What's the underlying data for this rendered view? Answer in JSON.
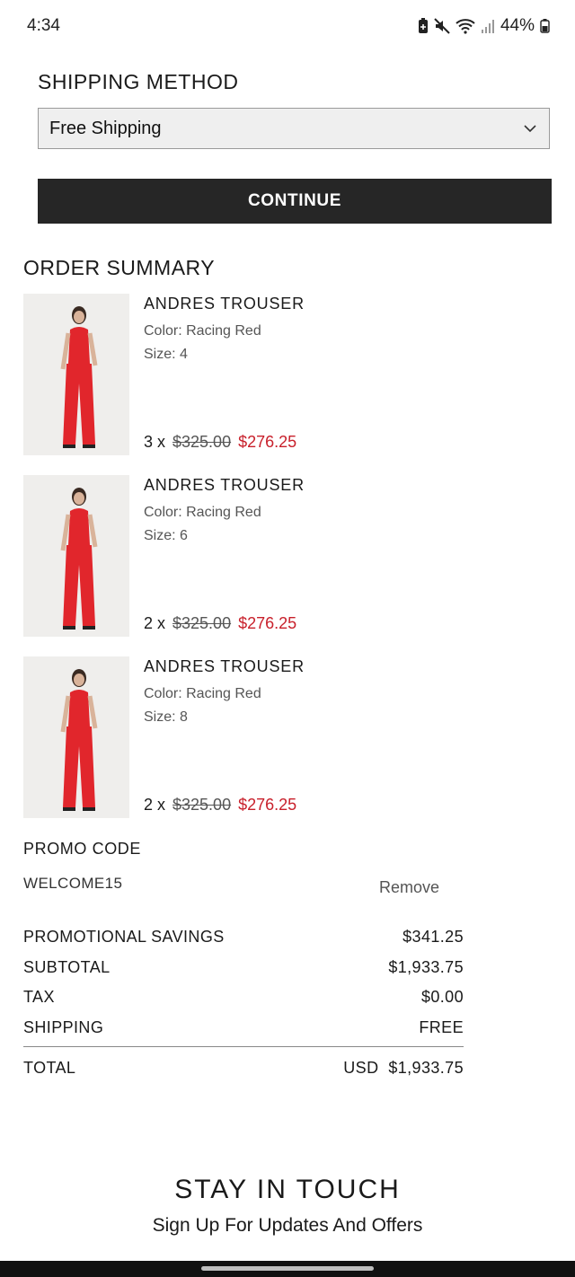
{
  "status_bar": {
    "time": "4:34",
    "battery": "44%"
  },
  "shipping": {
    "title": "SHIPPING METHOD",
    "selected_option": "Free Shipping",
    "continue_label": "CONTINUE"
  },
  "order_summary": {
    "title": "ORDER SUMMARY",
    "items": [
      {
        "name": "ANDRES TROUSER",
        "color": "Color: Racing Red",
        "size": "Size: 4",
        "qty": "3 x",
        "old_price": "$325.00",
        "new_price": "$276.25"
      },
      {
        "name": "ANDRES TROUSER",
        "color": "Color: Racing Red",
        "size": "Size: 6",
        "qty": "2 x",
        "old_price": "$325.00",
        "new_price": "$276.25"
      },
      {
        "name": "ANDRES TROUSER",
        "color": "Color: Racing Red",
        "size": "Size: 8",
        "qty": "2 x",
        "old_price": "$325.00",
        "new_price": "$276.25"
      }
    ]
  },
  "promo": {
    "title": "PROMO CODE",
    "code": "WELCOME15",
    "remove_label": "Remove"
  },
  "totals": {
    "promotional_savings_label": "PROMOTIONAL SAVINGS",
    "promotional_savings": "$341.25",
    "subtotal_label": "SUBTOTAL",
    "subtotal": "$1,933.75",
    "tax_label": "TAX",
    "tax": "$0.00",
    "shipping_label": "SHIPPING",
    "shipping": "FREE",
    "total_label": "TOTAL",
    "total_currency": "USD",
    "total": "$1,933.75"
  },
  "newsletter": {
    "title": "STAY IN TOUCH",
    "subtitle": "Sign Up For Updates And Offers"
  },
  "colors": {
    "sale_price": "#c8202b",
    "button_bg": "#262626",
    "product_red": "#e1262c"
  },
  "icons": [
    "battery-saver-icon",
    "mute-icon",
    "wifi-icon",
    "signal-icon",
    "battery-icon",
    "chevron-down-icon"
  ]
}
